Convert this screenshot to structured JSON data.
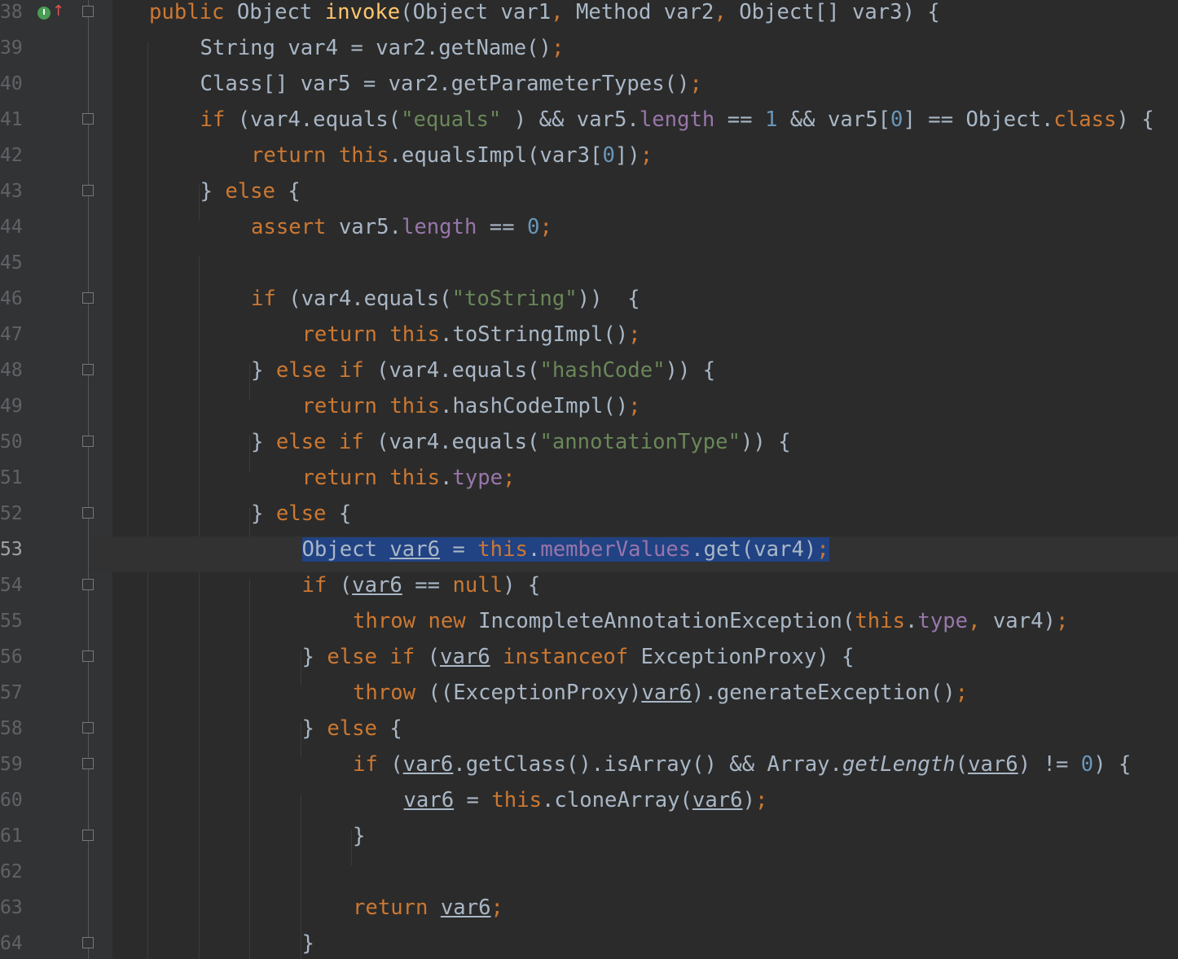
{
  "editor": {
    "language": "Java",
    "current_line": 53,
    "colors": {
      "background": "#2b2b2b",
      "gutter": "#313335",
      "keyword": "#cc7832",
      "function": "#ffc66d",
      "string": "#6a8759",
      "number": "#6897bb",
      "field": "#9876aa",
      "default": "#a9b7c6",
      "selection": "#214283"
    },
    "gutter_icon": {
      "name": "implements-method-icon",
      "glyph": "I",
      "arrow": "↑"
    },
    "lines": [
      {
        "num": "38",
        "indent": 0,
        "fold": "start",
        "tokens": [
          [
            "k",
            "public "
          ],
          [
            "",
            "Object "
          ],
          [
            "f",
            "invoke"
          ],
          [
            "",
            "(Object var1"
          ],
          [
            "k",
            ", "
          ],
          [
            "",
            "Method var2"
          ],
          [
            "k",
            ", "
          ],
          [
            "",
            "Object[] var3) {"
          ]
        ]
      },
      {
        "num": "39",
        "indent": 1,
        "tokens": [
          [
            "",
            "String var4 = var2.getName()"
          ],
          [
            "k",
            ";"
          ]
        ]
      },
      {
        "num": "40",
        "indent": 1,
        "tokens": [
          [
            "",
            "Class[] var5 = var2.getParameterTypes()"
          ],
          [
            "k",
            ";"
          ]
        ]
      },
      {
        "num": "41",
        "indent": 1,
        "fold": "start",
        "tokens": [
          [
            "k",
            "if "
          ],
          [
            "",
            "(var4.equals("
          ],
          [
            "s",
            "\"equals\""
          ],
          [
            "",
            " ) && var5."
          ],
          [
            "m",
            "length"
          ],
          [
            "",
            " == "
          ],
          [
            "n",
            "1"
          ],
          [
            "",
            " && var5["
          ],
          [
            "n",
            "0"
          ],
          [
            "",
            "] == Object."
          ],
          [
            "k",
            "class"
          ],
          [
            "",
            ") {"
          ]
        ]
      },
      {
        "num": "42",
        "indent": 2,
        "tokens": [
          [
            "k",
            "return this"
          ],
          [
            "",
            ".equalsImpl(var3["
          ],
          [
            "n",
            "0"
          ],
          [
            "",
            "])"
          ],
          [
            "k",
            ";"
          ]
        ]
      },
      {
        "num": "43",
        "indent": 1,
        "fold": "end",
        "tokens": [
          [
            "",
            "} "
          ],
          [
            "k",
            "else "
          ],
          [
            "",
            "{"
          ]
        ]
      },
      {
        "num": "44",
        "indent": 2,
        "tokens": [
          [
            "k",
            "assert "
          ],
          [
            "",
            "var5."
          ],
          [
            "m",
            "length"
          ],
          [
            "",
            " == "
          ],
          [
            "n",
            "0"
          ],
          [
            "k",
            ";"
          ]
        ]
      },
      {
        "num": "45",
        "indent": 2,
        "tokens": []
      },
      {
        "num": "46",
        "indent": 2,
        "fold": "start",
        "tokens": [
          [
            "k",
            "if "
          ],
          [
            "",
            "(var4.equals("
          ],
          [
            "s",
            "\"toString\""
          ],
          [
            "",
            "))  {"
          ]
        ]
      },
      {
        "num": "47",
        "indent": 3,
        "tokens": [
          [
            "k",
            "return this"
          ],
          [
            "",
            ".toStringImpl()"
          ],
          [
            "k",
            ";"
          ]
        ]
      },
      {
        "num": "48",
        "indent": 2,
        "fold": "end",
        "tokens": [
          [
            "",
            "} "
          ],
          [
            "k",
            "else if "
          ],
          [
            "",
            "(var4.equals("
          ],
          [
            "s",
            "\"hashCode\""
          ],
          [
            "",
            ")) {"
          ]
        ]
      },
      {
        "num": "49",
        "indent": 3,
        "tokens": [
          [
            "k",
            "return this"
          ],
          [
            "",
            ".hashCodeImpl()"
          ],
          [
            "k",
            ";"
          ]
        ]
      },
      {
        "num": "50",
        "indent": 2,
        "fold": "end",
        "tokens": [
          [
            "",
            "} "
          ],
          [
            "k",
            "else if "
          ],
          [
            "",
            "(var4.equals("
          ],
          [
            "s",
            "\"annotationType\""
          ],
          [
            "",
            ")) {"
          ]
        ]
      },
      {
        "num": "51",
        "indent": 3,
        "tokens": [
          [
            "k",
            "return this"
          ],
          [
            "",
            "."
          ],
          [
            "m",
            "type"
          ],
          [
            "k",
            ";"
          ]
        ]
      },
      {
        "num": "52",
        "indent": 2,
        "fold": "end",
        "tokens": [
          [
            "",
            "} "
          ],
          [
            "k",
            "else "
          ],
          [
            "",
            "{"
          ]
        ]
      },
      {
        "num": "53",
        "indent": 3,
        "current": true,
        "tokens": [
          [
            "sel",
            "Object "
          ],
          [
            "sel u",
            "var6"
          ],
          [
            "sel",
            " = "
          ],
          [
            "sel k",
            "this"
          ],
          [
            "sel",
            "."
          ],
          [
            "sel m",
            "memberValues"
          ],
          [
            "sel",
            ".get(var4)"
          ],
          [
            "sel k",
            ";"
          ]
        ]
      },
      {
        "num": "54",
        "indent": 3,
        "fold": "start",
        "tokens": [
          [
            "k",
            "if "
          ],
          [
            "",
            "("
          ],
          [
            "u",
            "var6"
          ],
          [
            "",
            " == "
          ],
          [
            "k",
            "null"
          ],
          [
            "",
            ") {"
          ]
        ]
      },
      {
        "num": "55",
        "indent": 4,
        "tokens": [
          [
            "k",
            "throw new "
          ],
          [
            "",
            "IncompleteAnnotationException("
          ],
          [
            "k",
            "this"
          ],
          [
            "",
            "."
          ],
          [
            "m",
            "type"
          ],
          [
            "k",
            ", "
          ],
          [
            "",
            "var4)"
          ],
          [
            "k",
            ";"
          ]
        ]
      },
      {
        "num": "56",
        "indent": 3,
        "fold": "end",
        "tokens": [
          [
            "",
            "} "
          ],
          [
            "k",
            "else if "
          ],
          [
            "",
            "("
          ],
          [
            "u",
            "var6"
          ],
          [
            "k",
            " instanceof "
          ],
          [
            "",
            "ExceptionProxy) {"
          ]
        ]
      },
      {
        "num": "57",
        "indent": 4,
        "tokens": [
          [
            "k",
            "throw "
          ],
          [
            "",
            "((ExceptionProxy)"
          ],
          [
            "u",
            "var6"
          ],
          [
            "",
            ").generateException()"
          ],
          [
            "k",
            ";"
          ]
        ]
      },
      {
        "num": "58",
        "indent": 3,
        "fold": "end",
        "tokens": [
          [
            "",
            "} "
          ],
          [
            "k",
            "else "
          ],
          [
            "",
            "{"
          ]
        ]
      },
      {
        "num": "59",
        "indent": 4,
        "fold": "start",
        "tokens": [
          [
            "k",
            "if "
          ],
          [
            "",
            "("
          ],
          [
            "u",
            "var6"
          ],
          [
            "",
            ".getClass().isArray() && Array."
          ],
          [
            "i",
            "getLength"
          ],
          [
            "",
            "("
          ],
          [
            "u",
            "var6"
          ],
          [
            "",
            ") != "
          ],
          [
            "n",
            "0"
          ],
          [
            "",
            ") {"
          ]
        ]
      },
      {
        "num": "60",
        "indent": 5,
        "tokens": [
          [
            "u",
            "var6"
          ],
          [
            "",
            " = "
          ],
          [
            "k",
            "this"
          ],
          [
            "",
            ".cloneArray("
          ],
          [
            "u",
            "var6"
          ],
          [
            "",
            ")"
          ],
          [
            "k",
            ";"
          ]
        ]
      },
      {
        "num": "61",
        "indent": 4,
        "fold": "end",
        "tokens": [
          [
            "",
            "}"
          ]
        ]
      },
      {
        "num": "62",
        "indent": 4,
        "tokens": []
      },
      {
        "num": "63",
        "indent": 4,
        "tokens": [
          [
            "k",
            "return "
          ],
          [
            "u",
            "var6"
          ],
          [
            "k",
            ";"
          ]
        ]
      },
      {
        "num": "64",
        "indent": 3,
        "fold": "end",
        "tokens": [
          [
            "",
            "}"
          ]
        ]
      }
    ]
  }
}
